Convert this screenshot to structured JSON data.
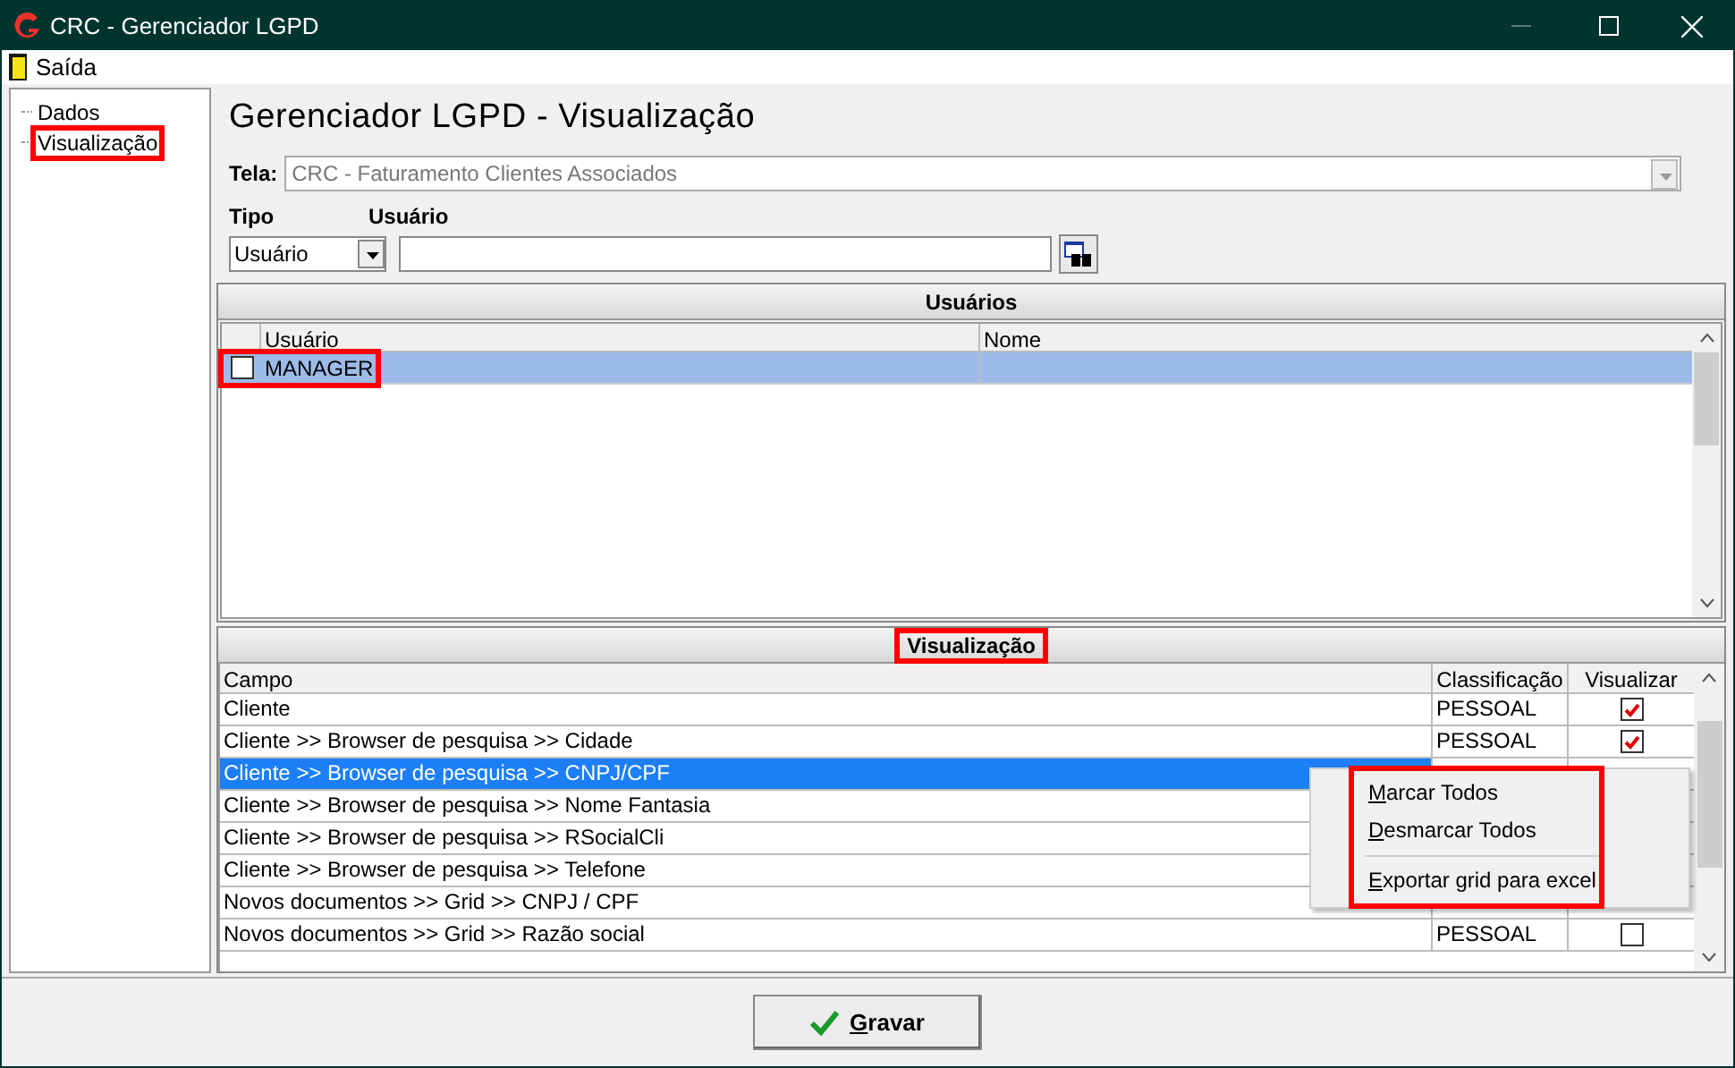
{
  "window": {
    "title": "CRC - Gerenciador LGPD"
  },
  "menu": [
    {
      "label": "Saída"
    }
  ],
  "tree": [
    {
      "label": "Dados",
      "highlight": false
    },
    {
      "label": "Visualização",
      "highlight": true
    }
  ],
  "heading": "Gerenciador LGPD - Visualização",
  "tela": {
    "label": "Tela:",
    "value": "CRC - Faturamento Clientes Associados",
    "disabled": true
  },
  "tipo": {
    "label": "Tipo",
    "value": "Usuário"
  },
  "usuario": {
    "label": "Usuário"
  },
  "users_section": {
    "title": "Usuários",
    "highlight": false,
    "columns": [
      "Usuário",
      "Nome"
    ],
    "rows": [
      {
        "usuario": "MANAGER",
        "checked": false,
        "selected": true,
        "highlight": true
      }
    ]
  },
  "view_section": {
    "title": "Visualização",
    "highlight": true,
    "columns": [
      "Campo",
      "Classificação",
      "Visualizar"
    ],
    "rows": [
      {
        "campo": "Cliente",
        "classificacao": "PESSOAL",
        "checked": true,
        "selected": false
      },
      {
        "campo": "Cliente >> Browser de pesquisa >> Cidade",
        "classificacao": "PESSOAL",
        "checked": true,
        "selected": false
      },
      {
        "campo": "Cliente >> Browser de pesquisa >> CNPJ/CPF",
        "selected": true
      },
      {
        "campo": "Cliente >> Browser de pesquisa >> Nome Fantasia",
        "selected": false
      },
      {
        "campo": "Cliente >> Browser de pesquisa >> RSocialCli",
        "selected": false
      },
      {
        "campo": "Cliente >> Browser de pesquisa >> Telefone",
        "selected": false
      },
      {
        "campo": "Novos documentos >> Grid >> CNPJ / CPF",
        "selected": false
      },
      {
        "campo": "Novos documentos >> Grid >> Razão social",
        "classificacao": "PESSOAL",
        "checked": false,
        "selected": false
      }
    ]
  },
  "context_menu": {
    "highlight": true,
    "items": [
      {
        "kind": "item",
        "label": "Marcar Todos"
      },
      {
        "kind": "item",
        "label": "Desmarcar Todos"
      },
      {
        "kind": "separator"
      },
      {
        "kind": "item",
        "label": "Exportar grid para excel"
      }
    ]
  },
  "save_button": {
    "label": "Gravar"
  }
}
